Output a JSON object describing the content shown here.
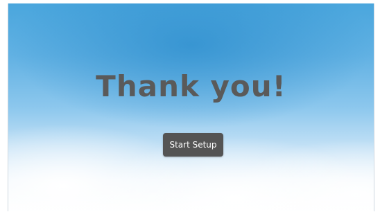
{
  "screen": {
    "title": "Thank you!",
    "start_button_label": "Start Setup"
  }
}
